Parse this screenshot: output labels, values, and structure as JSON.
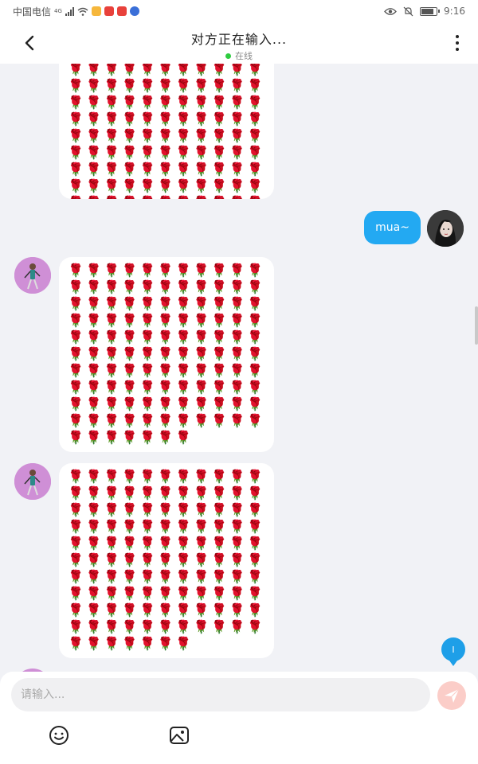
{
  "status_bar": {
    "carrier": "中国电信",
    "network": "4G",
    "time": "9:16"
  },
  "header": {
    "title": "对方正在输入...",
    "presence": "在线",
    "presence_color": "#2ecc40"
  },
  "messages": [
    {
      "direction": "incoming",
      "type": "emoji_grid",
      "emoji": "rose",
      "glyph": "🌹"
    },
    {
      "direction": "outgoing",
      "type": "text",
      "text": "mua~"
    },
    {
      "direction": "incoming",
      "type": "emoji_grid",
      "emoji": "rose",
      "glyph": "🌹"
    },
    {
      "direction": "incoming",
      "type": "emoji_grid",
      "emoji": "rose",
      "glyph": "🌹"
    }
  ],
  "unread_badge": "I",
  "composer": {
    "placeholder": "请输入...",
    "value": ""
  },
  "colors": {
    "accent": "#23a9f2",
    "send_button": "#fbcdc8",
    "rose": "#d10b1c"
  },
  "icons": [
    "back-arrow-icon",
    "more-vertical-icon",
    "send-icon",
    "emoji-icon",
    "image-icon"
  ]
}
